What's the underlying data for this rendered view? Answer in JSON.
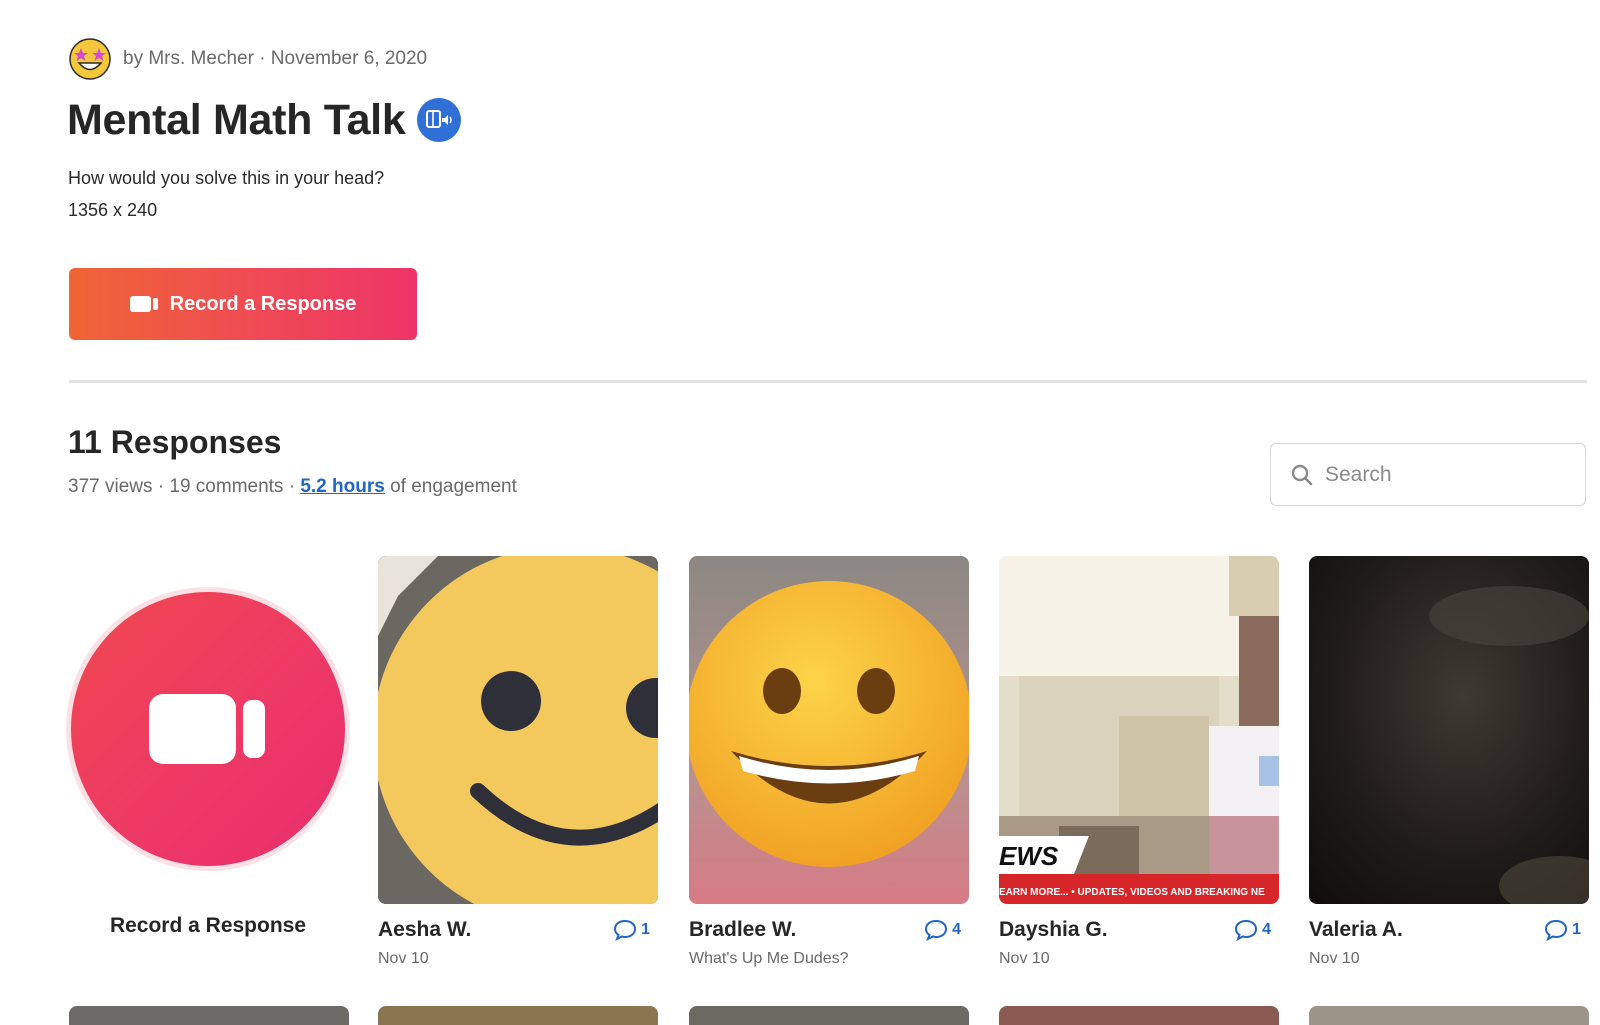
{
  "post": {
    "meta": "by Mrs. Mecher · November 6, 2020",
    "title": "Mental Math Talk",
    "prompt_line1": "How would you solve this in your head?",
    "prompt_line2": "1356 x 240",
    "record_button_label": "Record a Response",
    "avatar_icon": "star-struck-emoji-icon",
    "badge_icon": "immersive-reader-icon"
  },
  "responses": {
    "heading": "11 Responses",
    "views": "377 views",
    "comments": "19 comments",
    "engagement_value": "5.2 hours",
    "engagement_suffix": "of engagement",
    "search_placeholder": "Search",
    "record_tile_label": "Record a Response",
    "items": [
      {
        "name": "Aesha W.",
        "comments": "1",
        "subtitle": "Nov 10",
        "thumb": "smiley-face"
      },
      {
        "name": "Bradlee W.",
        "comments": "4",
        "subtitle": "What's Up Me Dudes?",
        "thumb": "grinning-emoji"
      },
      {
        "name": "Dayshia G.",
        "comments": "4",
        "subtitle": "Nov 10",
        "thumb": "pixelated-video"
      },
      {
        "name": "Valeria A.",
        "comments": "1",
        "subtitle": "Nov 10",
        "thumb": "dark-video"
      }
    ],
    "news_banner": "EWS",
    "news_ticker": "EARN MORE...  •  UPDATES, VIDEOS AND BREAKING NE"
  },
  "colors": {
    "accent_blue": "#2166c6",
    "record_gradient_start": "#ef6535",
    "record_gradient_end": "#ec3468"
  }
}
